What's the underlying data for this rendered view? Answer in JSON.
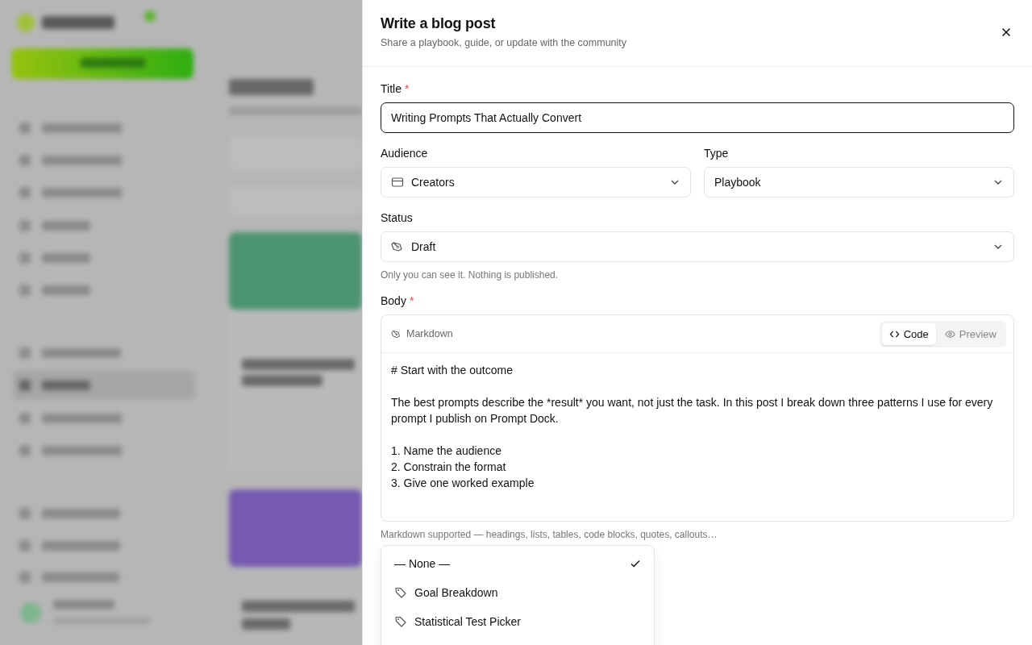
{
  "drawer": {
    "title": "Write a blog post",
    "subtitle": "Share a playbook, guide, or update with the community"
  },
  "fields": {
    "title": {
      "label": "Title",
      "required_mark": "*",
      "value": "Writing Prompts That Actually Convert"
    },
    "audience": {
      "label": "Audience",
      "value": "Creators"
    },
    "type": {
      "label": "Type",
      "value": "Playbook"
    },
    "status": {
      "label": "Status",
      "value": "Draft",
      "hint": "Only you can see it. Nothing is published."
    }
  },
  "body": {
    "label": "Body",
    "required_mark": "*",
    "format": "Markdown",
    "modes": [
      {
        "label": "Code",
        "kind": "code",
        "selected": true
      },
      {
        "label": "Preview",
        "kind": "preview",
        "selected": false
      }
    ],
    "text": "# Start with the outcome\n\nThe best prompts describe the *result* you want, not just the task. In this post I break down three patterns I use for every prompt I publish on Prompt Dock.\n\n1. Name the audience\n2. Constrain the format\n3. Give one worked example",
    "hint": "Markdown supported — headings, lists, tables, code blocks, quotes, callouts…"
  },
  "dropdown": {
    "options": [
      {
        "label": "— None —",
        "kind": "none",
        "selected": true
      },
      {
        "label": "Goal Breakdown",
        "kind": "tag",
        "selected": false
      },
      {
        "label": "Statistical Test Picker",
        "kind": "tag",
        "selected": false
      }
    ]
  }
}
